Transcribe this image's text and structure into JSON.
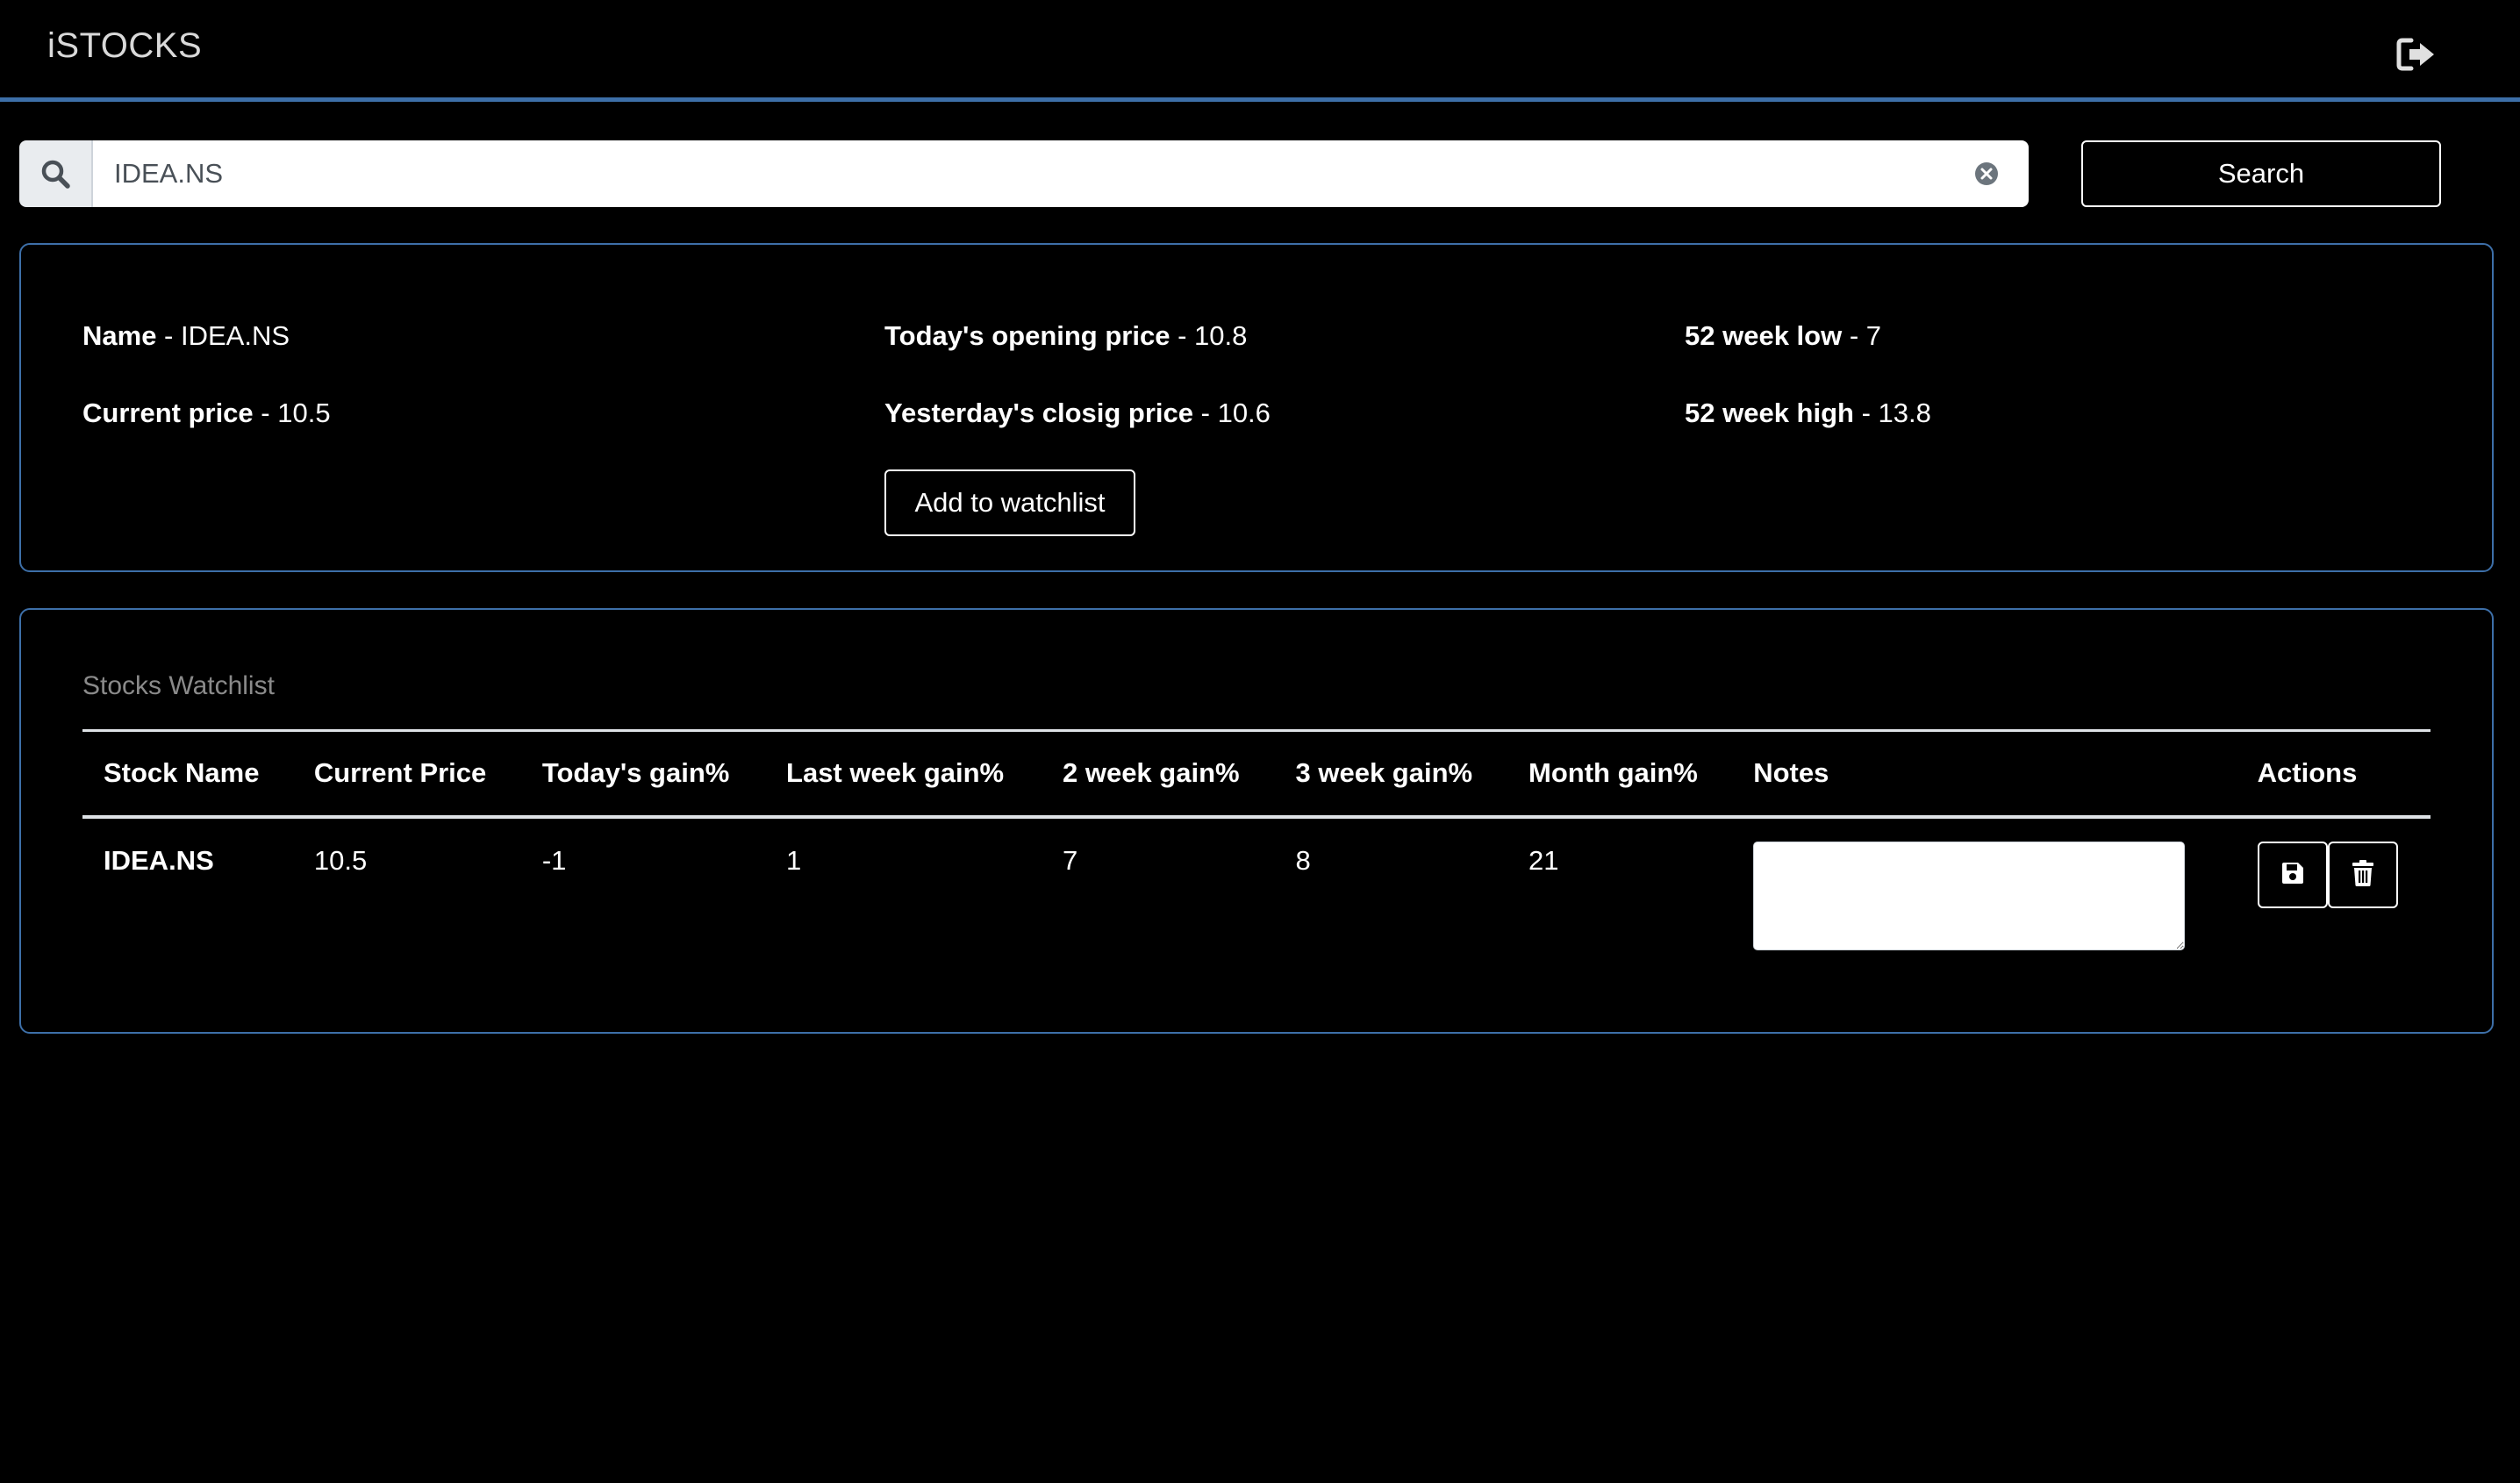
{
  "app": {
    "brand": "iSTOCKS"
  },
  "search": {
    "value": "IDEA.NS",
    "button_label": "Search"
  },
  "details": {
    "name_label": "Name",
    "name_value": "IDEA.NS",
    "current_price_label": "Current price",
    "current_price_value": "10.5",
    "opening_label": "Today's opening price",
    "opening_value": "10.8",
    "closing_label": "Yesterday's closig price",
    "closing_value": "10.6",
    "low_label": "52 week low",
    "low_value": "7",
    "high_label": "52 week high",
    "high_value": "13.8",
    "separator": " - ",
    "add_button_label": "Add to watchlist"
  },
  "watchlist": {
    "title": "Stocks Watchlist",
    "columns": {
      "stock_name": "Stock Name",
      "current_price": "Current Price",
      "todays_gain": "Today's gain%",
      "last_week_gain": "Last week gain%",
      "two_week_gain": "2 week gain%",
      "three_week_gain": "3 week gain%",
      "month_gain": "Month gain%",
      "notes": "Notes",
      "actions": "Actions"
    },
    "rows": [
      {
        "stock_name": "IDEA.NS",
        "current_price": "10.5",
        "todays_gain": "-1",
        "last_week_gain": "1",
        "two_week_gain": "7",
        "three_week_gain": "8",
        "month_gain": "21",
        "notes": ""
      }
    ]
  },
  "icons": {
    "logout": "sign-out-icon",
    "search": "search-icon",
    "clear": "clear-circle-icon",
    "save": "floppy-disk-icon",
    "delete": "trash-icon"
  },
  "colors": {
    "accent": "#3d6fa8",
    "background": "#000000",
    "muted_text": "#8a8a8a"
  }
}
